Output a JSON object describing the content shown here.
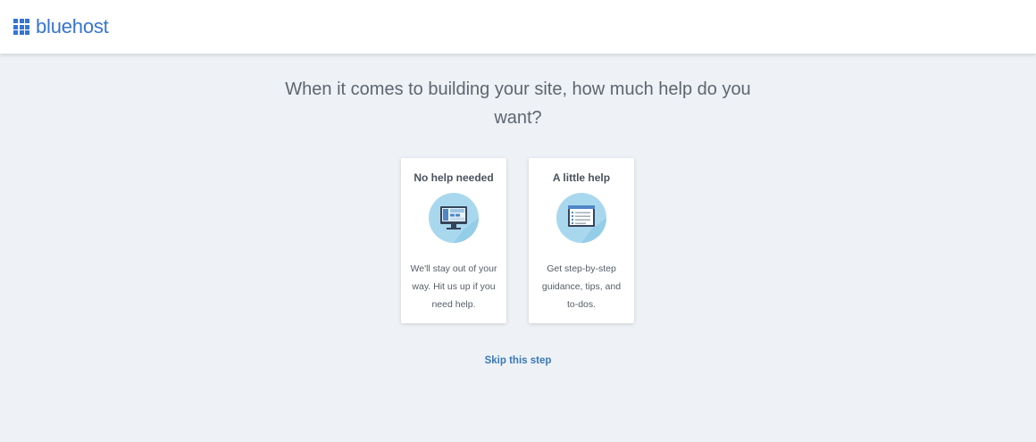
{
  "header": {
    "logo_text": "bluehost",
    "logo_icon": "grid-icon",
    "brand_color": "#3575d3"
  },
  "main": {
    "question": "When it comes to building your site, how much help do you want?",
    "options": [
      {
        "title": "No help needed",
        "icon": "monitor-icon",
        "description": "We'll stay out of your way. Hit us up if you need help."
      },
      {
        "title": "A little help",
        "icon": "checklist-icon",
        "description": "Get step-by-step guidance, tips, and to-dos."
      }
    ],
    "skip_label": "Skip this step",
    "link_color": "#3a78b8"
  }
}
